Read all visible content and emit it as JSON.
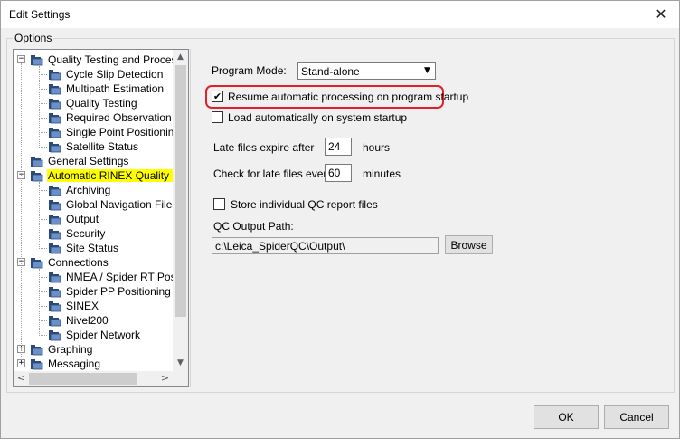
{
  "window": {
    "title": "Edit Settings",
    "close_glyph": "✕"
  },
  "options_group": {
    "label": "Options"
  },
  "tree": {
    "nodes": [
      {
        "label": "Quality Testing and Process",
        "depth": 0,
        "expander": "−"
      },
      {
        "label": "Cycle Slip Detection",
        "depth": 1
      },
      {
        "label": "Multipath Estimation",
        "depth": 1
      },
      {
        "label": "Quality Testing",
        "depth": 1
      },
      {
        "label": "Required Observation T",
        "depth": 1
      },
      {
        "label": "Single Point Positioning",
        "depth": 1
      },
      {
        "label": "Satellite Status",
        "depth": 1
      },
      {
        "label": "General Settings",
        "depth": 0
      },
      {
        "label": "Automatic RINEX Quality Ch",
        "depth": 0,
        "expander": "−",
        "selected": true
      },
      {
        "label": "Archiving",
        "depth": 1
      },
      {
        "label": "Global Navigation Files",
        "depth": 1
      },
      {
        "label": "Output",
        "depth": 1
      },
      {
        "label": "Security",
        "depth": 1
      },
      {
        "label": "Site Status",
        "depth": 1
      },
      {
        "label": "Connections",
        "depth": 0,
        "expander": "−"
      },
      {
        "label": "NMEA / Spider RT Posi",
        "depth": 1
      },
      {
        "label": "Spider PP Positioning",
        "depth": 1
      },
      {
        "label": "SINEX",
        "depth": 1
      },
      {
        "label": "Nivel200",
        "depth": 1
      },
      {
        "label": "Spider Network",
        "depth": 1
      },
      {
        "label": "Graphing",
        "depth": 0,
        "expander": "+"
      },
      {
        "label": "Messaging",
        "depth": 0,
        "expander": "+"
      }
    ],
    "scroll_up": "▲",
    "scroll_down": "▼",
    "scroll_left": "<",
    "scroll_right": ">"
  },
  "settings": {
    "program_mode_label": "Program Mode:",
    "program_mode_value": "Stand-alone",
    "dropdown_glyph": "▼",
    "resume_label": "Resume automatic processing on program startup",
    "resume_checked": true,
    "load_label": "Load automatically on system startup",
    "load_checked": false,
    "late_expire_label": "Late files expire after",
    "late_expire_value": "24",
    "late_expire_unit": "hours",
    "check_late_label": "Check for late files every",
    "check_late_value": "60",
    "check_late_unit": "minutes",
    "store_qc_label": "Store individual QC report files",
    "store_qc_checked": false,
    "qc_path_label": "QC Output Path:",
    "qc_path_value": "c:\\Leica_SpiderQC\\Output\\",
    "browse_label": "Browse",
    "check_glyph": "✔"
  },
  "footer": {
    "ok_label": "OK",
    "cancel_label": "Cancel"
  },
  "colors": {
    "selection": "#ffff00",
    "highlight_outline": "#e0202a",
    "folder": "#2a4a7a"
  }
}
